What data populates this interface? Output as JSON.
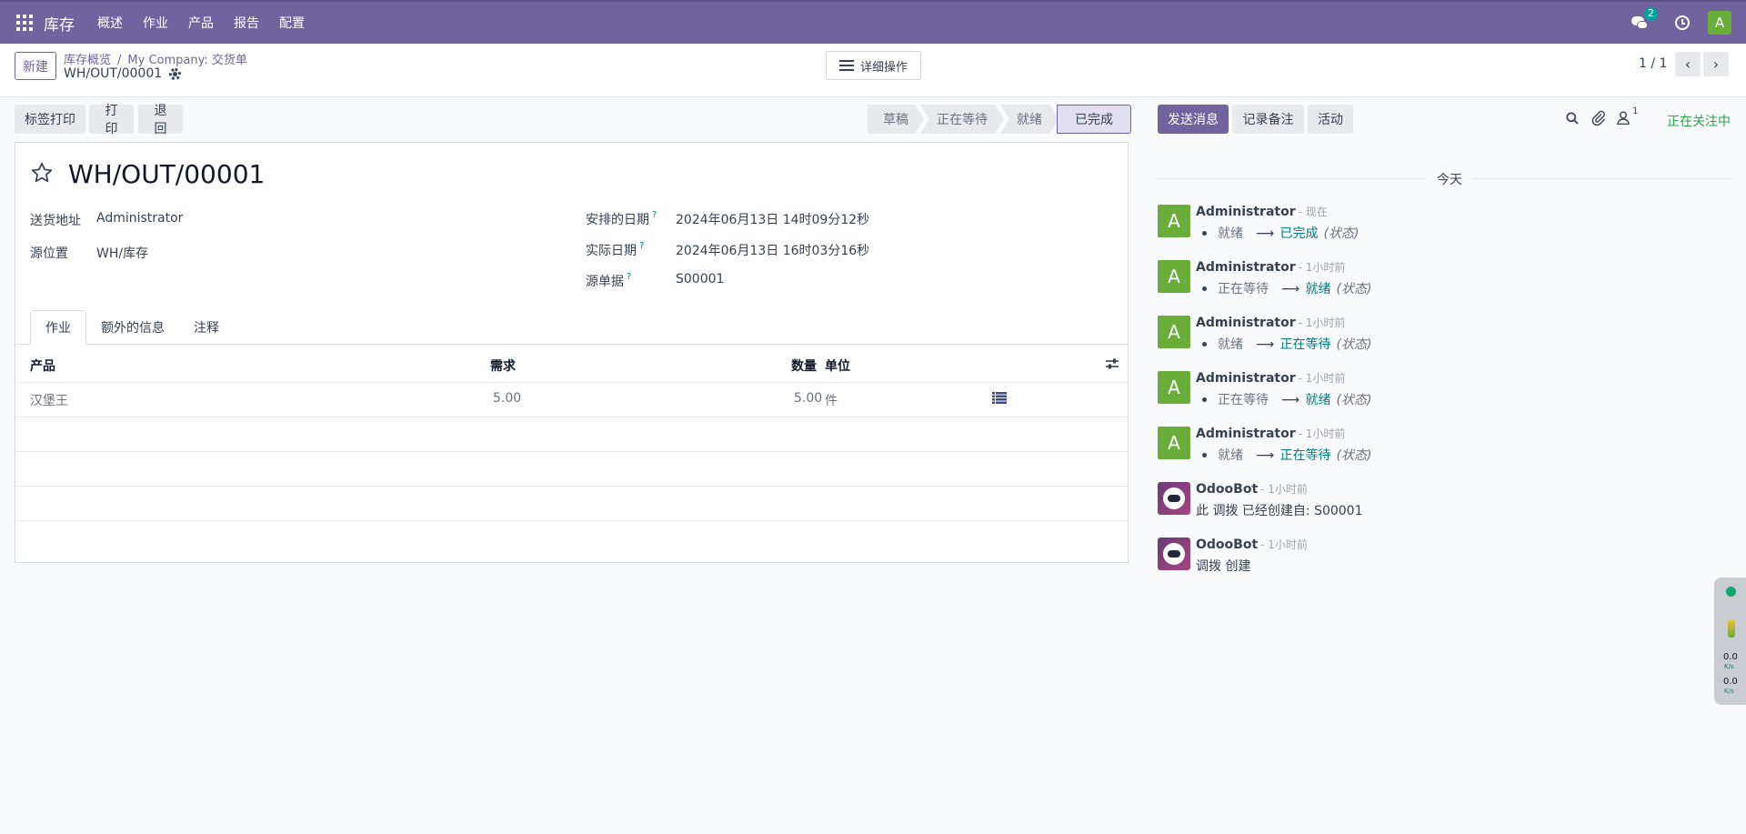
{
  "navbar": {
    "brand": "库存",
    "menu": [
      "概述",
      "作业",
      "产品",
      "报告",
      "配置"
    ],
    "chat_badge": "2",
    "avatar": "A"
  },
  "control": {
    "new_label": "新建",
    "breadcrumb": [
      "库存概览",
      "My Company: 交货单"
    ],
    "record": "WH/OUT/00001",
    "actions_label": "详细操作",
    "pager": "1 / 1"
  },
  "actions": {
    "print_labels": "标签打印",
    "print": "打印",
    "return": "退回"
  },
  "status": {
    "steps": [
      "草稿",
      "正在等待",
      "就绪",
      "已完成"
    ],
    "active_index": 3
  },
  "form": {
    "title": "WH/OUT/00001",
    "delivery_address_label": "送货地址",
    "delivery_address": "Administrator",
    "source_location_label": "源位置",
    "source_location": "WH/库存",
    "scheduled_label": "安排的日期",
    "scheduled": "2024年06月13日 14时09分12秒",
    "effective_label": "实际日期",
    "effective": "2024年06月13日 16时03分16秒",
    "source_doc_label": "源单据",
    "source_doc": "S00001",
    "help": "?"
  },
  "tabs": [
    "作业",
    "额外的信息",
    "注释"
  ],
  "table": {
    "headers": {
      "product": "产品",
      "demand": "需求",
      "quantity": "数量",
      "uom": "单位"
    },
    "rows": [
      {
        "product": "汉堡王",
        "demand": "5.00",
        "quantity": "5.00",
        "uom": "件"
      }
    ]
  },
  "chatter": {
    "send_message": "发送消息",
    "log_note": "记录备注",
    "activity": "活动",
    "follower_count": "1",
    "following": "正在关注中",
    "today": "今天",
    "messages": [
      {
        "author": "Administrator",
        "time": "- 现在",
        "old": "就绪",
        "new": "已完成",
        "field": "(状态)"
      },
      {
        "author": "Administrator",
        "time": "- 1小时前",
        "old": "正在等待",
        "new": "就绪",
        "field": "(状态)"
      },
      {
        "author": "Administrator",
        "time": "- 1小时前",
        "old": "就绪",
        "new": "正在等待",
        "field": "(状态)"
      },
      {
        "author": "Administrator",
        "time": "- 1小时前",
        "old": "正在等待",
        "new": "就绪",
        "field": "(状态)"
      },
      {
        "author": "Administrator",
        "time": "- 1小时前",
        "old": "就绪",
        "new": "正在等待",
        "field": "(状态)"
      }
    ],
    "bot_messages": [
      {
        "author": "OdooBot",
        "time": "- 1小时前",
        "text": "此 调拨 已经创建自: S00001"
      },
      {
        "author": "OdooBot",
        "time": "- 1小时前",
        "text": "调拨 创建"
      }
    ],
    "arrow": "⟶",
    "avatar": "A"
  },
  "widget": {
    "up": "0.0",
    "down": "0.0",
    "unit": "K/s"
  },
  "colors": {
    "primary": "#71639e",
    "avatar_green": "#6aad3a",
    "link_teal": "#017e84",
    "following_green": "#28a745"
  }
}
